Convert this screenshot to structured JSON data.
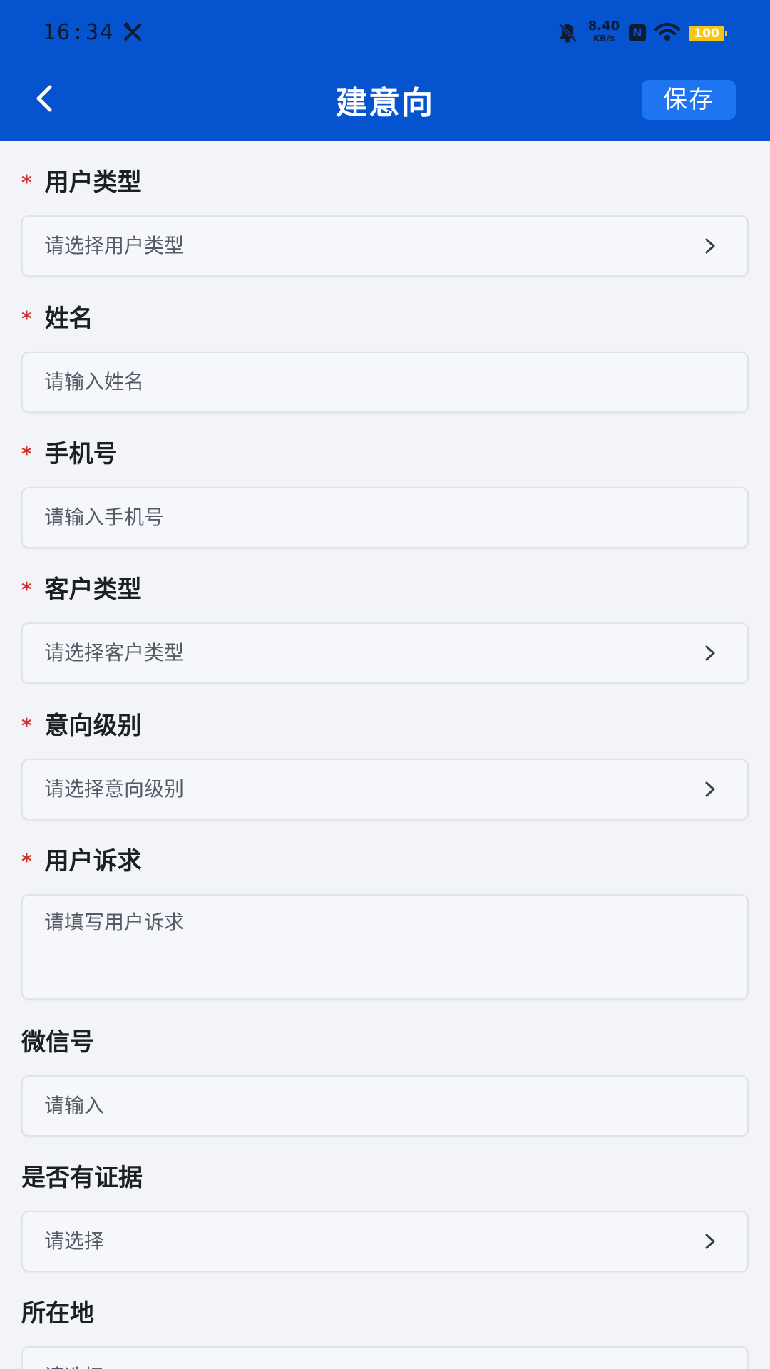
{
  "status_bar": {
    "time": "16:34",
    "speed_value": "8.40",
    "speed_unit": "KB/s",
    "battery": "100",
    "icons": [
      "tools-icon",
      "bell-off-icon",
      "nfc-icon",
      "wifi-icon",
      "battery-icon"
    ]
  },
  "header": {
    "title": "建意向",
    "save_label": "保存",
    "back_icon": "chevron-left-icon"
  },
  "colors": {
    "header_bg": "#0653cf",
    "save_button_bg": "#1f74ef",
    "required_star": "#d0312d",
    "page_bg": "#f2f4f7"
  },
  "form": {
    "fields": [
      {
        "label": "用户类型",
        "required": true,
        "type": "select",
        "placeholder": "请选择用户类型"
      },
      {
        "label": "姓名",
        "required": true,
        "type": "input",
        "placeholder": "请输入姓名"
      },
      {
        "label": "手机号",
        "required": true,
        "type": "input",
        "placeholder": "请输入手机号"
      },
      {
        "label": "客户类型",
        "required": true,
        "type": "select",
        "placeholder": "请选择客户类型"
      },
      {
        "label": "意向级别",
        "required": true,
        "type": "select",
        "placeholder": "请选择意向级别"
      },
      {
        "label": "用户诉求",
        "required": true,
        "type": "textarea",
        "placeholder": "请填写用户诉求"
      },
      {
        "label": "微信号",
        "required": false,
        "type": "input",
        "placeholder": "请输入"
      },
      {
        "label": "是否有证据",
        "required": false,
        "type": "select",
        "placeholder": "请选择"
      },
      {
        "label": "所在地",
        "required": false,
        "type": "select",
        "placeholder": "请选择"
      }
    ],
    "required_mark": "*"
  }
}
